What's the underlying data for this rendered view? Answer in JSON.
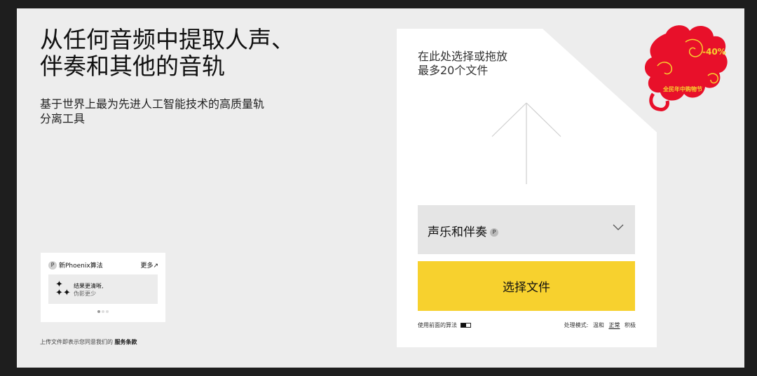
{
  "hero": {
    "title_line1": "从任何音频中提取人声、",
    "title_line2": "伴奏和其他的音轨",
    "subtitle_line1": "基于世界上最为先进人工智能技术的高质量轨",
    "subtitle_line2": "分离工具"
  },
  "algo_card": {
    "badge": "P",
    "title": "新Phoenix算法",
    "more_label": "更多↗",
    "feature_line1": "结果更清晰,",
    "feature_line2": "伪影更少",
    "slides": 3,
    "active_slide": 1
  },
  "terms": {
    "text": "上传文件即表示您同意我们的",
    "link": "服务条款"
  },
  "upload": {
    "drop_line1": "在此处选择或拖放",
    "drop_line2": "最多20个文件",
    "separator": {
      "selected": "声乐和伴奏",
      "badge": "P"
    },
    "choose_button": "选择文件",
    "prev_algo_label": "使用前面的算法",
    "mode": {
      "label": "处理模式:",
      "options": [
        "温和",
        "正常",
        "积极"
      ],
      "active": "正常"
    }
  },
  "promo": {
    "discount": "-40%",
    "text": "全民年中购物节",
    "colors": {
      "cloud": "#e8102a",
      "text": "#f7d12e"
    }
  },
  "colors": {
    "accent": "#f7d12e",
    "panel": "#ffffff",
    "page": "#ededed",
    "outer": "#1e1e1e"
  }
}
